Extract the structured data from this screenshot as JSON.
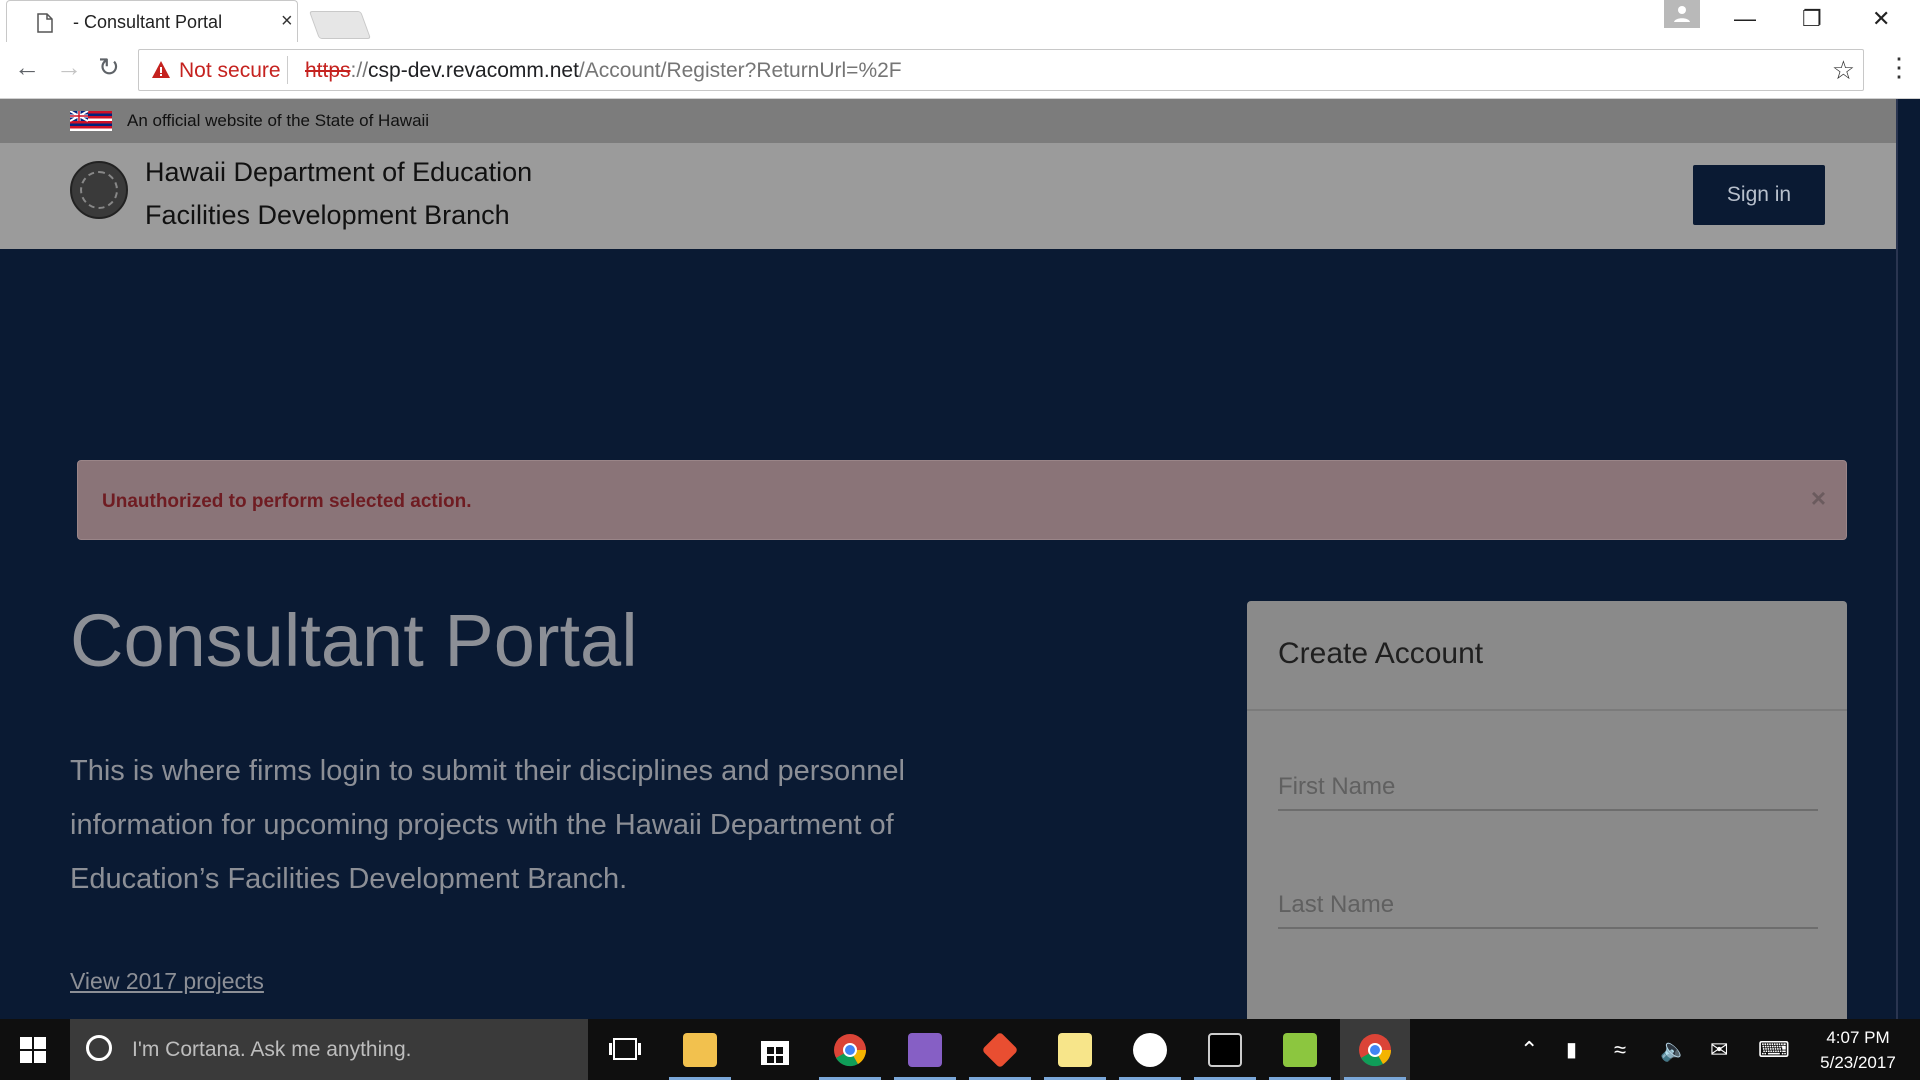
{
  "browser": {
    "tab_title": "- Consultant Portal",
    "close_glyph": "×",
    "url_scheme": "https",
    "url_sep": "://",
    "url_host": "csp-dev.revacomm.net",
    "url_path": "/Account/Register?ReturnUrl=%2F",
    "security_label": "Not secure"
  },
  "banner": {
    "official_text": "An official website of the State of Hawaii"
  },
  "header": {
    "org_line1": "Hawaii Department of Education",
    "org_line2": "Facilities Development Branch",
    "signin_label": "Sign in"
  },
  "alert": {
    "message": "Unauthorized to perform selected action.",
    "close_glyph": "×"
  },
  "hero": {
    "title": "Consultant Portal",
    "description": "This is where firms login to submit their disciplines and personnel information for upcoming projects with the Hawaii Department of Education’s Facilities Development Branch.",
    "link_label": "View 2017 projects"
  },
  "create_account": {
    "heading": "Create Account",
    "first_name_placeholder": "First Name",
    "last_name_placeholder": "Last Name"
  },
  "taskbar": {
    "search_placeholder": "I'm Cortana. Ask me anything.",
    "time": "4:07 PM",
    "date": "5/23/2017",
    "pinned": [
      {
        "name": "task-view-icon"
      },
      {
        "name": "file-explorer-icon",
        "color": "#f2c14e"
      },
      {
        "name": "store-icon",
        "color": "#ffffff"
      },
      {
        "name": "chrome-icon",
        "color": "#4285f4"
      },
      {
        "name": "visual-studio-icon",
        "color": "#865fc5"
      },
      {
        "name": "git-icon",
        "color": "#e94e31"
      },
      {
        "name": "sticky-notes-icon",
        "color": "#f7e58a"
      },
      {
        "name": "slack-icon",
        "color": "#ffffff"
      },
      {
        "name": "terminal-icon",
        "color": "#000000"
      },
      {
        "name": "notepad-plus-icon",
        "color": "#8cc63f"
      },
      {
        "name": "chrome-icon",
        "color": "#4285f4"
      }
    ]
  },
  "colors": {
    "page_bg": "#0a1a33",
    "alert_text": "#6f1c22",
    "insecure_red": "#c5221f"
  }
}
